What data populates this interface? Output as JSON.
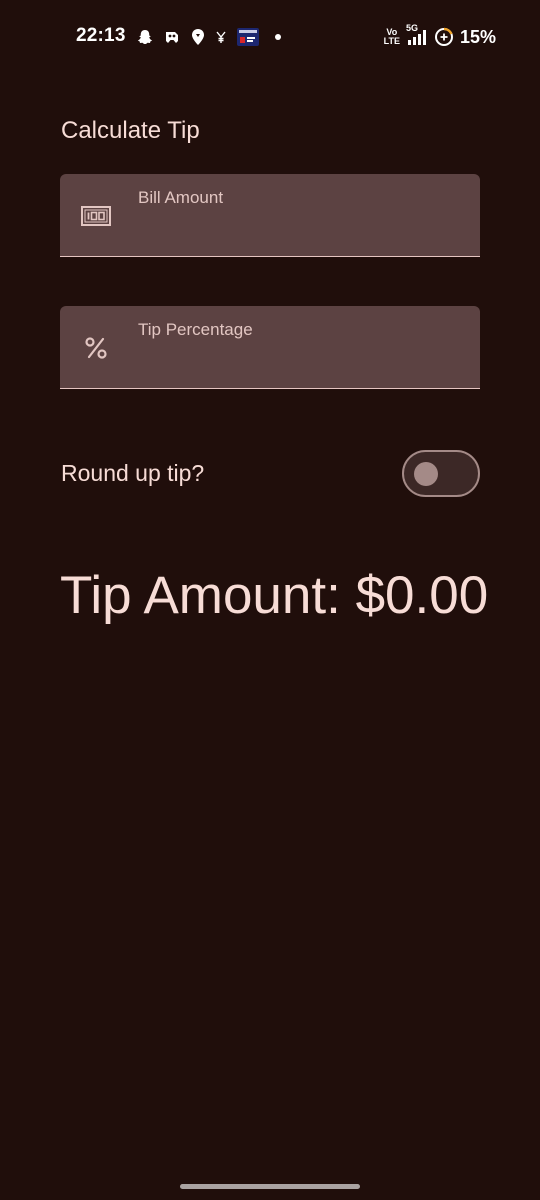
{
  "status_bar": {
    "time": "22:13",
    "battery_percent": "15%",
    "network_top": "Vo",
    "network_bottom": "LTE",
    "network_type": "5G",
    "icons": [
      "snapchat-icon",
      "game-controller-icon",
      "location-pin-icon",
      "yen-notification-icon",
      "news-app-icon",
      "notification-dot-icon",
      "signal-bars-icon",
      "battery-saver-icon"
    ]
  },
  "app": {
    "title": "Calculate Tip"
  },
  "form": {
    "bill_amount": {
      "label": "Bill Amount",
      "value": "",
      "icon": "money-icon"
    },
    "tip_percentage": {
      "label": "Tip Percentage",
      "value": "",
      "icon": "percent-icon"
    },
    "round_up": {
      "label": "Round up tip?",
      "checked": false
    }
  },
  "result": {
    "tip_amount_text": "Tip Amount: $0.00"
  },
  "colors": {
    "background": "#200e0b",
    "text": "#f7dcd6",
    "field_bg": "#5c4242",
    "field_label": "#e2c6c2",
    "switch_outline": "#a48a87"
  }
}
